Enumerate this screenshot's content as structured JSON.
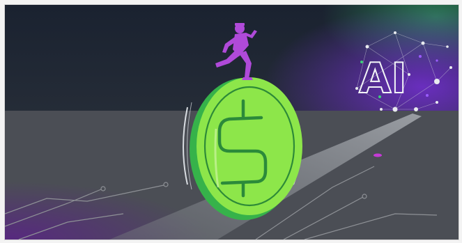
{
  "illustration": {
    "scene": "runner-on-dollar-coin-racing-toward-ai",
    "colors": {
      "sky_top": "#1c2430",
      "sky_bottom": "#2f3640",
      "floor": "#4a4d53",
      "beam": "#7c8086",
      "coin": "#8ee44a",
      "coin_edge": "#4cc43e",
      "dollar": "#2b8a3a",
      "runner": "#b24ad8",
      "glow_purple": "#8a2be2",
      "glow_green": "#3fae6b"
    },
    "ai_sign": {
      "letters": "AI",
      "icon": "ai-network-icon"
    }
  }
}
